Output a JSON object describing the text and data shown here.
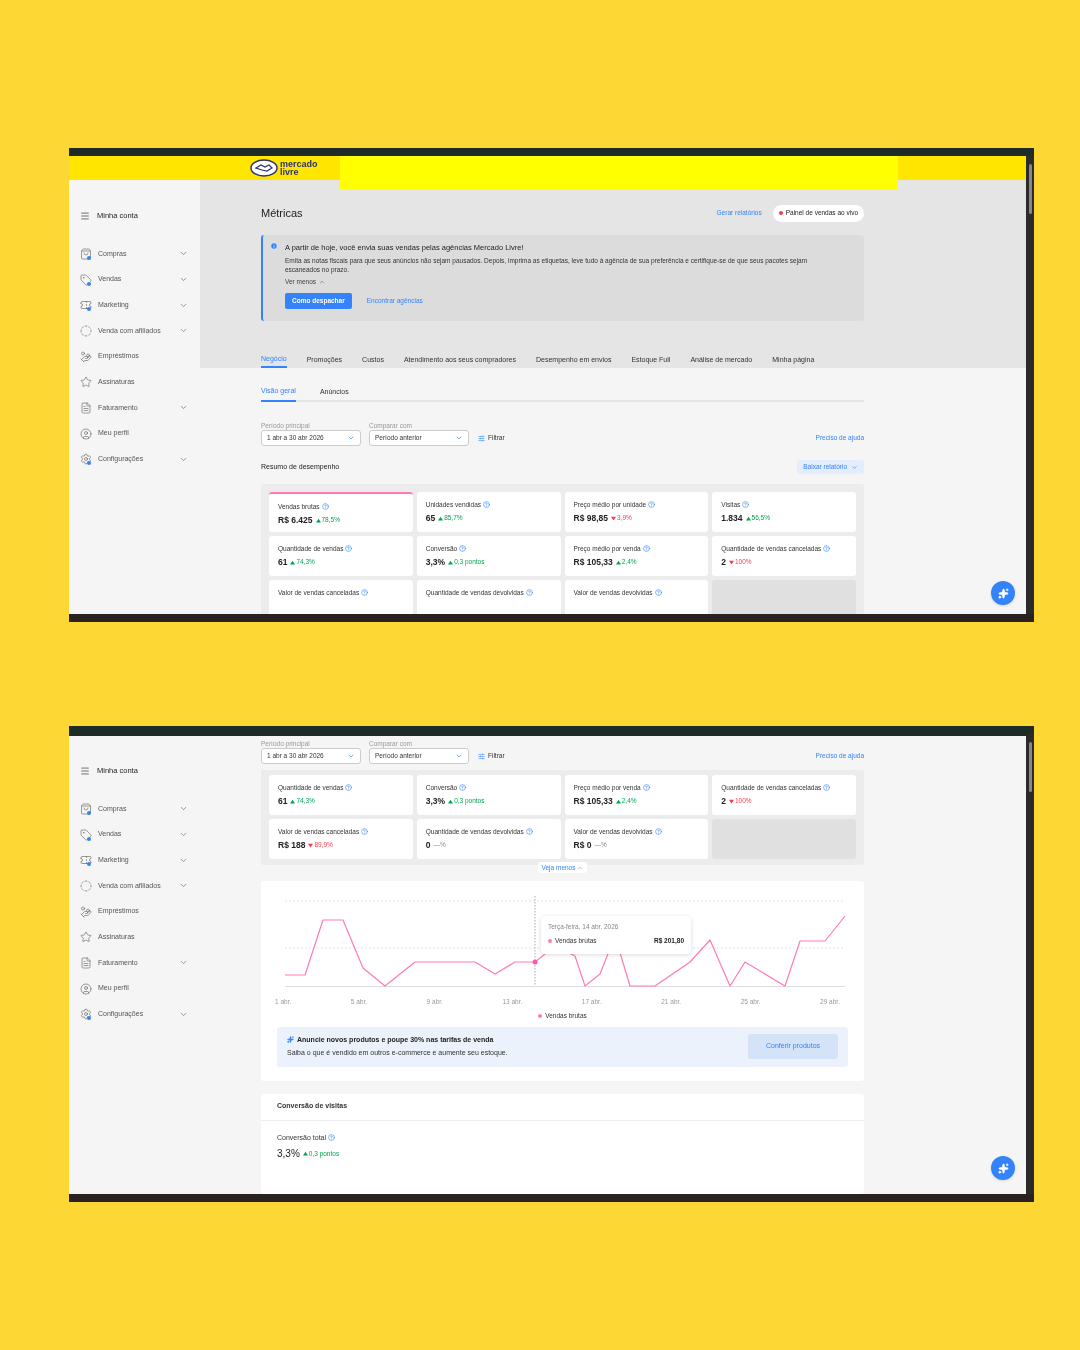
{
  "screens": [
    {
      "kind": "top",
      "logo": {
        "line1": "mercado",
        "line2": "livre"
      },
      "sidebar": {
        "title": "Minha conta",
        "items": [
          {
            "label": "Compras",
            "dot": true,
            "expandable": true
          },
          {
            "label": "Vendas",
            "dot": true,
            "expandable": true
          },
          {
            "label": "Marketing",
            "dot": true,
            "expandable": true
          },
          {
            "label": "Venda com afiliados",
            "dot": false,
            "expandable": true
          },
          {
            "label": "Empréstimos",
            "dot": false,
            "expandable": false
          },
          {
            "label": "Assinaturas",
            "dot": false,
            "expandable": false
          },
          {
            "label": "Faturamento",
            "dot": false,
            "expandable": true
          },
          {
            "label": "Meu perfil",
            "dot": false,
            "expandable": false
          },
          {
            "label": "Configurações",
            "dot": true,
            "expandable": true
          }
        ]
      },
      "page_title": "Métricas",
      "report_link": "Gerar relatórios",
      "live_panel": {
        "label": "Painel de vendas ao vivo",
        "live": true
      },
      "notice": {
        "title": "A partir de hoje, você envia suas vendas pelas agências Mercado Livre!",
        "body": "Emita as notas fiscais para que seus anúncios não sejam pausados. Depois, imprima as etiquetas, leve tudo à agência de sua preferência e certifique-se de que seus pacotes sejam escaneados no prazo.",
        "toggle": "Ver menos",
        "button": "Como despachar",
        "link": "Encontrar agências"
      },
      "tabs": [
        {
          "label": "Negócio",
          "selected": true
        },
        {
          "label": "Promoções",
          "selected": false
        },
        {
          "label": "Custos",
          "selected": false
        },
        {
          "label": "Atendimento aos seus compradores",
          "selected": false
        },
        {
          "label": "Desempenho em envios",
          "selected": false
        },
        {
          "label": "Estoque Full",
          "selected": false
        },
        {
          "label": "Análise de mercado",
          "selected": false
        },
        {
          "label": "Minha página",
          "selected": false
        }
      ],
      "subtabs": [
        {
          "label": "Visão geral",
          "selected": true
        },
        {
          "label": "Anúncios",
          "selected": false
        }
      ],
      "filters": {
        "period_label": "Período principal",
        "period": "1 abr a 30 abr 2026",
        "compare_label": "Comparar com",
        "compare": "Período anterior",
        "filter": "Filtrar",
        "help": "Preciso de ajuda"
      },
      "summary": {
        "title": "Resumo de desempenho",
        "download": "Baixar relatório"
      },
      "cards": [
        {
          "kind": "metric",
          "label": "Vendas brutas",
          "value": "R$ 6.425",
          "up": true,
          "down": false,
          "change": "78,5%",
          "selected": true
        },
        {
          "kind": "metric",
          "label": "Unidades vendidas",
          "value": "65",
          "up": true,
          "down": false,
          "change": "85,7%",
          "selected": false
        },
        {
          "kind": "metric",
          "label": "Preço médio por unidade",
          "value": "R$ 98,85",
          "up": false,
          "down": true,
          "change": "3,9%",
          "selected": false
        },
        {
          "kind": "metric",
          "label": "Visitas",
          "value": "1.834",
          "up": true,
          "down": false,
          "change": "56,5%",
          "selected": false
        },
        {
          "kind": "metric",
          "label": "Quantidade de vendas",
          "value": "61",
          "up": true,
          "down": false,
          "change": "74,3%",
          "selected": false
        },
        {
          "kind": "metric",
          "label": "Conversão",
          "value": "3,3%",
          "up": true,
          "down": false,
          "change": "0,3 pontos",
          "selected": false
        },
        {
          "kind": "metric",
          "label": "Preço médio por venda",
          "value": "R$ 105,33",
          "up": true,
          "down": false,
          "change": "2,4%",
          "selected": false
        },
        {
          "kind": "metric",
          "label": "Quantidade de vendas canceladas",
          "value": "2",
          "up": false,
          "down": true,
          "change": "100%",
          "selected": false
        },
        {
          "kind": "metric",
          "label": "Valor de vendas canceladas",
          "selected": false
        },
        {
          "kind": "metric",
          "label": "Quantidade de vendas devolvidas",
          "selected": false
        },
        {
          "kind": "metric",
          "label": "Valor de vendas devolvidas",
          "selected": false
        },
        {
          "kind": "empty"
        }
      ]
    },
    {
      "kind": "scrolled",
      "sidebar": {
        "title": "Minha conta",
        "items": [
          {
            "label": "Compras",
            "dot": true,
            "expandable": true
          },
          {
            "label": "Vendas",
            "dot": true,
            "expandable": true
          },
          {
            "label": "Marketing",
            "dot": true,
            "expandable": true
          },
          {
            "label": "Venda com afiliados",
            "dot": false,
            "expandable": true
          },
          {
            "label": "Empréstimos",
            "dot": false,
            "expandable": false
          },
          {
            "label": "Assinaturas",
            "dot": false,
            "expandable": false
          },
          {
            "label": "Faturamento",
            "dot": false,
            "expandable": true
          },
          {
            "label": "Meu perfil",
            "dot": false,
            "expandable": false
          },
          {
            "label": "Configurações",
            "dot": true,
            "expandable": true
          }
        ]
      },
      "filters": {
        "period_label": "Período principal",
        "period": "1 abr a 30 abr 2026",
        "compare_label": "Comparar com",
        "compare": "Período anterior",
        "filter": "Filtrar",
        "help": "Preciso de ajuda"
      },
      "cards": [
        {
          "kind": "metric",
          "label": "Quantidade de vendas",
          "value": "61",
          "up": true,
          "down": false,
          "change": "74,3%",
          "selected": false
        },
        {
          "kind": "metric",
          "label": "Conversão",
          "value": "3,3%",
          "up": true,
          "down": false,
          "change": "0,3 pontos",
          "selected": false
        },
        {
          "kind": "metric",
          "label": "Preço médio por venda",
          "value": "R$ 105,33",
          "up": true,
          "down": false,
          "change": "2,4%",
          "selected": false
        },
        {
          "kind": "metric",
          "label": "Quantidade de vendas canceladas",
          "value": "2",
          "up": false,
          "down": true,
          "change": "100%",
          "selected": false
        },
        {
          "kind": "metric",
          "label": "Valor de vendas canceladas",
          "value": "R$ 188",
          "up": false,
          "down": true,
          "change": "89,9%",
          "selected": false
        },
        {
          "kind": "metric",
          "label": "Quantidade de vendas devolvidas",
          "value": "0",
          "up": false,
          "down": false,
          "change": "—%",
          "selected": false
        },
        {
          "kind": "metric",
          "label": "Valor de vendas devolvidas",
          "value": "R$ 0",
          "up": false,
          "down": false,
          "change": "—%",
          "selected": false
        },
        {
          "kind": "empty"
        }
      ],
      "show_less": "Veja menos",
      "sales_chart": {
        "x_labels": [
          "1 abr.",
          "5 abr.",
          "9 abr.",
          "13 abr.",
          "17 abr.",
          "21 abr.",
          "25 abr.",
          "29 abr."
        ],
        "legend": "Vendas brutas",
        "tooltip": {
          "date": "Terça-feira, 14 abr. 2026",
          "series": "Vendas brutas",
          "value": "R$ 201,80"
        }
      },
      "promo": {
        "title": "Anuncie novos produtos e poupe 30% nas tarifas de venda",
        "text": "Saiba o que é vendido em outros e-commerce e aumente seu estoque.",
        "button": "Conferir produtos"
      },
      "conversion": {
        "title": "Conversão de visitas",
        "label": "Conversão total",
        "value": "3,3%",
        "up": true,
        "down": false,
        "change": "0,3 pontos"
      }
    }
  ]
}
